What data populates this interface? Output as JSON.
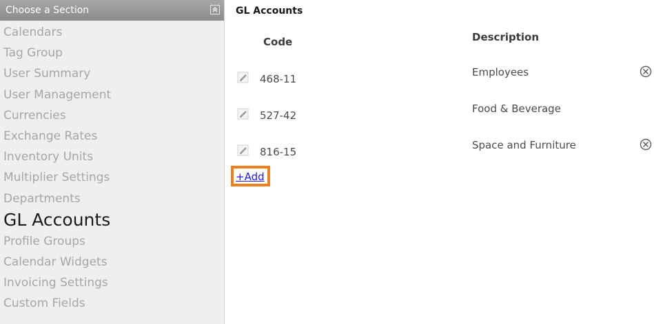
{
  "sidebar": {
    "header": "Choose a Section",
    "collapse_icon": "double-chevron-up-icon",
    "items": [
      {
        "label": "Calendars",
        "active": false
      },
      {
        "label": "Tag Group",
        "active": false
      },
      {
        "label": "User Summary",
        "active": false
      },
      {
        "label": "User Management",
        "active": false
      },
      {
        "label": "Currencies",
        "active": false
      },
      {
        "label": "Exchange Rates",
        "active": false
      },
      {
        "label": "Inventory Units",
        "active": false
      },
      {
        "label": "Multiplier Settings",
        "active": false
      },
      {
        "label": "Departments",
        "active": false
      },
      {
        "label": "GL Accounts",
        "active": true
      },
      {
        "label": "Profile Groups",
        "active": false
      },
      {
        "label": "Calendar Widgets",
        "active": false
      },
      {
        "label": "Invoicing Settings",
        "active": false
      },
      {
        "label": "Custom Fields",
        "active": false
      }
    ]
  },
  "main": {
    "title": "GL Accounts",
    "columns": {
      "code": "Code",
      "description": "Description"
    },
    "rows": [
      {
        "code": "468-11",
        "description": "Employees",
        "deletable": true
      },
      {
        "code": "527-42",
        "description": "Food & Beverage",
        "deletable": false
      },
      {
        "code": "816-15",
        "description": "Space and Furniture",
        "deletable": true
      }
    ],
    "add_label": "+Add"
  },
  "colors": {
    "highlight": "#f07d1e",
    "link": "#1a1aee",
    "sidebar_header": "#999999"
  }
}
